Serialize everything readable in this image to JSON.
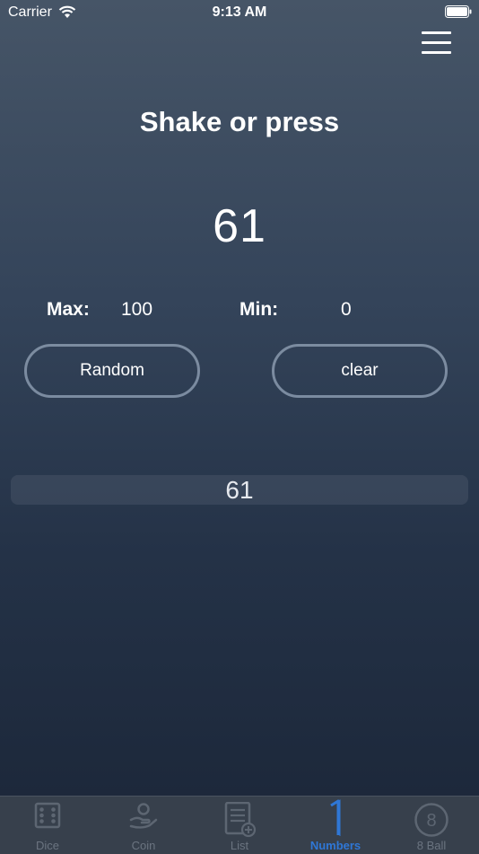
{
  "status_bar": {
    "carrier": "Carrier",
    "time": "9:13 AM"
  },
  "main": {
    "title": "Shake or press",
    "result": "61",
    "max_label": "Max:",
    "max_value": "100",
    "min_label": "Min:",
    "min_value": "0",
    "random_label": "Random",
    "clear_label": "clear"
  },
  "history": [
    "61"
  ],
  "tabs": [
    {
      "label": "Dice",
      "icon": "dice-icon"
    },
    {
      "label": "Coin",
      "icon": "coin-hand-icon"
    },
    {
      "label": "List",
      "icon": "list-add-icon"
    },
    {
      "label": "Numbers",
      "icon": "number-one-icon",
      "active": true
    },
    {
      "label": "8 Ball",
      "icon": "eight-ball-icon"
    }
  ],
  "colors": {
    "active_tab": "#2f77d6",
    "inactive_tab": "#6b7480"
  }
}
